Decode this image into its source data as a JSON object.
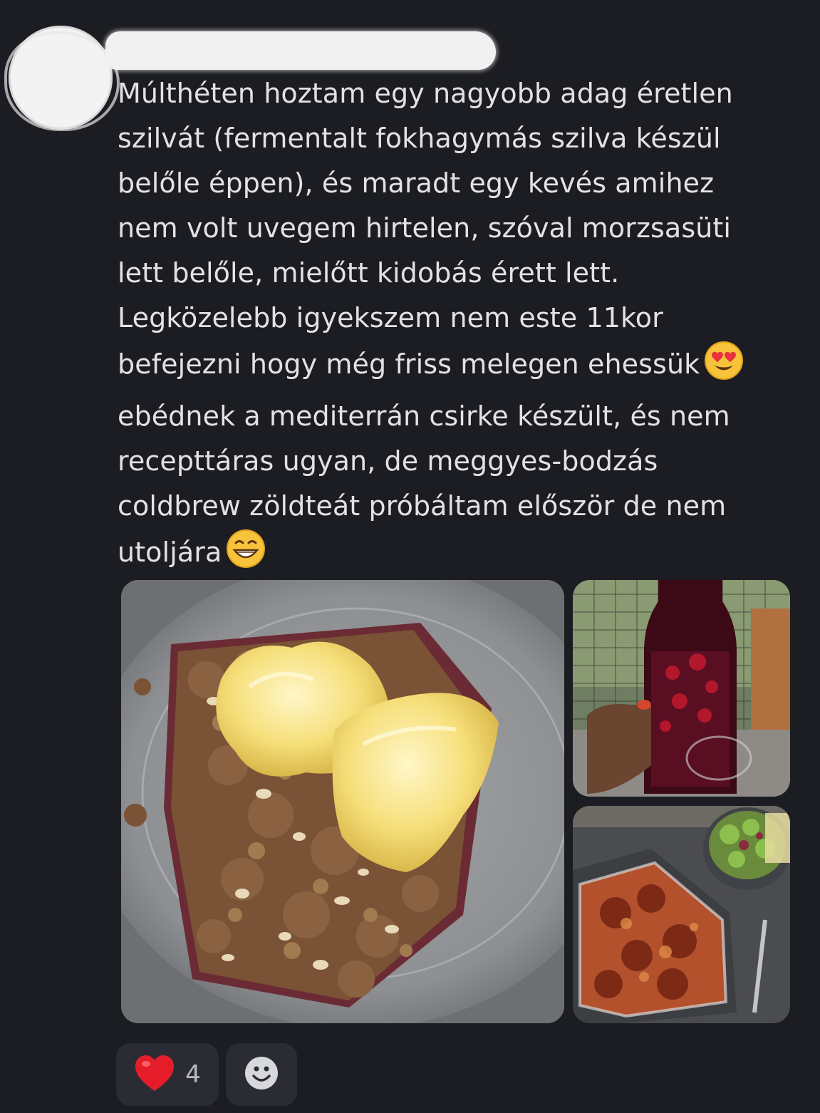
{
  "post": {
    "message_lines": [
      "Múlthéten hoztam egy nagyobb adag éretlen",
      "szilvát (fermentalt fokhagymás szilva készül",
      "belőle éppen), és maradt egy kevés amihez",
      "nem volt uvegem hirtelen, szóval morzsasüti",
      "lett belőle, mielőtt kidobás érett lett.",
      "Legközelebb igyekszem nem este 11kor",
      "befejezni hogy még friss melegen ehessük",
      "ebédnek a mediterrán csirke készült, és nem",
      "recepttáras ugyan, de meggyes-bodzás",
      "coldbrew zöldteát próbáltam először de nem",
      "utoljára"
    ],
    "inline_emojis": {
      "line_7": "heart-eyes-emoji",
      "line_11": "grinning-emoji"
    }
  },
  "images": [
    {
      "subject": "crumble-with-ice-cream"
    },
    {
      "subject": "cherry-elderflower-coldbrew-bottle"
    },
    {
      "subject": "mediterranean-chicken-and-salad"
    }
  ],
  "reactions": {
    "heart": {
      "icon": "heart-emoji",
      "count": "4"
    },
    "add": {
      "icon": "smiley-add-icon"
    }
  },
  "colors": {
    "background": "#1c1d22",
    "text": "#e2e2e6",
    "reaction_bg": "#2b2c33"
  }
}
